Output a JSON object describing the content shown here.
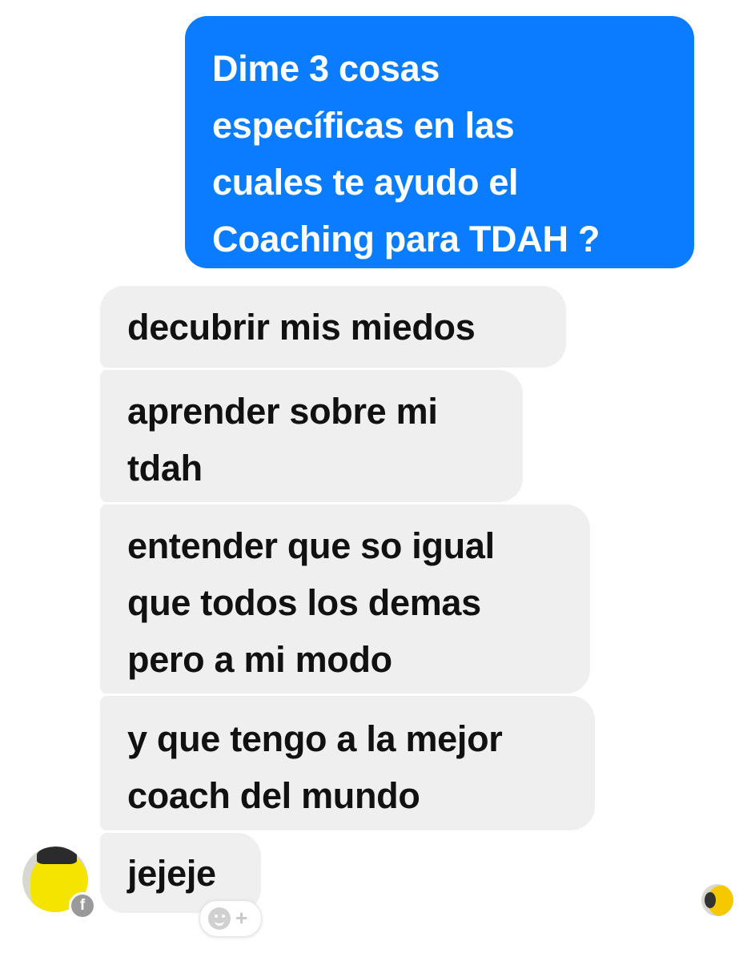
{
  "conversation": {
    "sent_message": {
      "lines": [
        "Dime 3 cosas",
        "específicas en las",
        "cuales te ayudo el",
        "Coaching para TDAH ?"
      ]
    },
    "received_messages": [
      {
        "lines": [
          "decubrir mis miedos"
        ]
      },
      {
        "lines": [
          "aprender sobre mi",
          "tdah"
        ]
      },
      {
        "lines": [
          "entender que so igual",
          "que todos los demas",
          "pero a mi modo"
        ]
      },
      {
        "lines": [
          "y que tengo a la mejor",
          "coach del mundo"
        ]
      },
      {
        "lines": [
          "jejeje"
        ]
      }
    ]
  },
  "badges": {
    "facebook_badge": "f",
    "react_plus": "+"
  },
  "icons": {
    "sender_avatar": "avatar-icon",
    "facebook_badge": "facebook-icon",
    "add_reaction": "smiley-plus-icon",
    "read_receipt": "read-receipt-avatar-icon"
  },
  "colors": {
    "sent_bubble": "#0a7cff",
    "received_bubble": "#efefef",
    "sent_text": "#ffffff",
    "received_text": "#111111"
  }
}
